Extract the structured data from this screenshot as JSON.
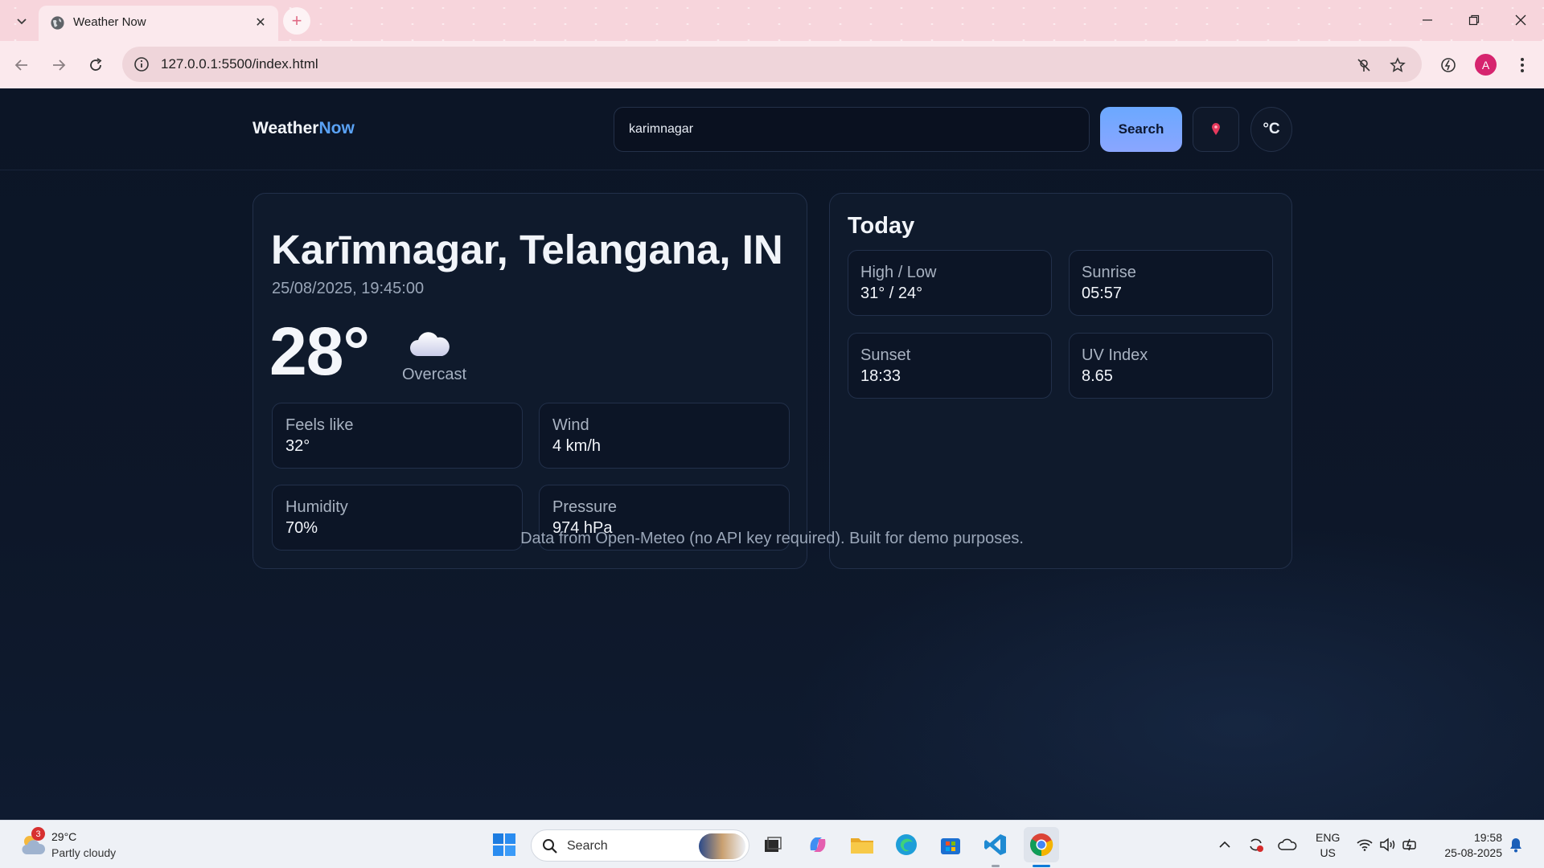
{
  "browser": {
    "tab_title": "Weather Now",
    "url": "127.0.0.1:5500/index.html",
    "profile_initial": "A"
  },
  "app": {
    "brand_main": "Weather",
    "brand_accent": "Now",
    "search_value": "karimnagar",
    "search_button": "Search",
    "unit_toggle": "°C",
    "location_icon": "pin-icon"
  },
  "current": {
    "city": "Karīmnagar, Telangana, IN",
    "datetime": "25/08/2025, 19:45:00",
    "temperature": "28°",
    "condition": "Overcast",
    "stats": [
      {
        "label": "Feels like",
        "value": "32°"
      },
      {
        "label": "Wind",
        "value": "4 km/h"
      },
      {
        "label": "Humidity",
        "value": "70%"
      },
      {
        "label": "Pressure",
        "value": "974 hPa"
      }
    ]
  },
  "today": {
    "title": "Today",
    "stats": [
      {
        "label": "High / Low",
        "value": "31° / 24°"
      },
      {
        "label": "Sunrise",
        "value": "05:57"
      },
      {
        "label": "Sunset",
        "value": "18:33"
      },
      {
        "label": "UV Index",
        "value": "8.65"
      }
    ]
  },
  "footer": "Data from Open-Meteo (no API key required). Built for demo purposes.",
  "taskbar": {
    "weather_temp": "29°C",
    "weather_cond": "Partly cloudy",
    "weather_badge": "3",
    "search_label": "Search",
    "lang_top": "ENG",
    "lang_bottom": "US",
    "time": "19:58",
    "date": "25-08-2025"
  },
  "colors": {
    "accent": "#5aa2f5",
    "page_bg": "#0c1526",
    "card_bg": "#0f1a2c",
    "search_button": "#6ba8ff"
  }
}
